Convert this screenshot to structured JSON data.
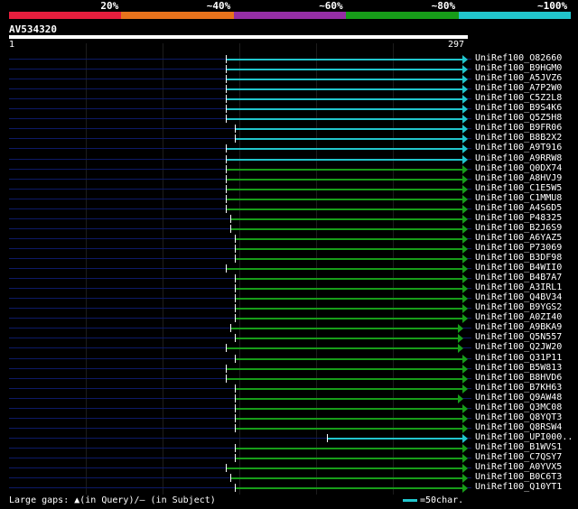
{
  "legend": {
    "segments": [
      {
        "label": "20%",
        "color": "#e51e3d"
      },
      {
        "label": "~40%",
        "color": "#e8731c"
      },
      {
        "label": "~60%",
        "color": "#952ea5"
      },
      {
        "label": "~80%",
        "color": "#179d19"
      },
      {
        "label": "~100%",
        "color": "#21c5cc"
      }
    ]
  },
  "query": {
    "name": "AV534320",
    "start_label": "1",
    "end_label": "297",
    "length": 297
  },
  "colors": {
    "cyan": "#21c5cc",
    "green": "#179d19",
    "track": "#0d1a66"
  },
  "hits": [
    {
      "name": "UniRef100_O82660",
      "start": 142,
      "end": 297,
      "color": "cyan"
    },
    {
      "name": "UniRef100_B9HGM0",
      "start": 142,
      "end": 297,
      "color": "cyan"
    },
    {
      "name": "UniRef100_A5JVZ6",
      "start": 142,
      "end": 297,
      "color": "cyan"
    },
    {
      "name": "UniRef100_A7P2W0",
      "start": 142,
      "end": 297,
      "color": "cyan"
    },
    {
      "name": "UniRef100_C5Z2L8",
      "start": 142,
      "end": 297,
      "color": "cyan"
    },
    {
      "name": "UniRef100_B9S4K6",
      "start": 142,
      "end": 297,
      "color": "cyan"
    },
    {
      "name": "UniRef100_Q5Z5H8",
      "start": 142,
      "end": 297,
      "color": "cyan"
    },
    {
      "name": "UniRef100_B9FR06",
      "start": 148,
      "end": 297,
      "color": "cyan"
    },
    {
      "name": "UniRef100_B8B2X2",
      "start": 148,
      "end": 297,
      "color": "cyan"
    },
    {
      "name": "UniRef100_A9T916",
      "start": 142,
      "end": 297,
      "color": "cyan"
    },
    {
      "name": "UniRef100_A9RRW8",
      "start": 142,
      "end": 297,
      "color": "cyan"
    },
    {
      "name": "UniRef100_Q0DX74",
      "start": 142,
      "end": 297,
      "color": "green"
    },
    {
      "name": "UniRef100_A8HVJ9",
      "start": 142,
      "end": 297,
      "color": "green"
    },
    {
      "name": "UniRef100_C1E5W5",
      "start": 142,
      "end": 297,
      "color": "green"
    },
    {
      "name": "UniRef100_C1MMU8",
      "start": 142,
      "end": 297,
      "color": "green"
    },
    {
      "name": "UniRef100_A4S6D5",
      "start": 142,
      "end": 297,
      "color": "green"
    },
    {
      "name": "UniRef100_P48325",
      "start": 145,
      "end": 297,
      "color": "green"
    },
    {
      "name": "UniRef100_B2J6S9",
      "start": 145,
      "end": 297,
      "color": "green"
    },
    {
      "name": "UniRef100_A6YAZ5",
      "start": 148,
      "end": 297,
      "color": "green"
    },
    {
      "name": "UniRef100_P73069",
      "start": 148,
      "end": 297,
      "color": "green"
    },
    {
      "name": "UniRef100_B3DF98",
      "start": 148,
      "end": 297,
      "color": "green"
    },
    {
      "name": "UniRef100_B4WII0",
      "start": 142,
      "end": 297,
      "color": "green"
    },
    {
      "name": "UniRef100_B4B7A7",
      "start": 148,
      "end": 297,
      "color": "green"
    },
    {
      "name": "UniRef100_A3IRL1",
      "start": 148,
      "end": 297,
      "color": "green"
    },
    {
      "name": "UniRef100_Q4BV34",
      "start": 148,
      "end": 297,
      "color": "green"
    },
    {
      "name": "UniRef100_B9YGS2",
      "start": 148,
      "end": 297,
      "color": "green"
    },
    {
      "name": "UniRef100_A0ZI40",
      "start": 148,
      "end": 297,
      "color": "green"
    },
    {
      "name": "UniRef100_A9BKA9",
      "start": 145,
      "end": 294,
      "color": "green"
    },
    {
      "name": "UniRef100_Q5N557",
      "start": 148,
      "end": 294,
      "color": "green"
    },
    {
      "name": "UniRef100_Q2JW20",
      "start": 142,
      "end": 294,
      "color": "green"
    },
    {
      "name": "UniRef100_Q31P11",
      "start": 148,
      "end": 297,
      "color": "green"
    },
    {
      "name": "UniRef100_B5W813",
      "start": 142,
      "end": 297,
      "color": "green"
    },
    {
      "name": "UniRef100_B8HVD6",
      "start": 142,
      "end": 297,
      "color": "green"
    },
    {
      "name": "UniRef100_B7KH63",
      "start": 148,
      "end": 297,
      "color": "green"
    },
    {
      "name": "UniRef100_Q9AW48",
      "start": 148,
      "end": 294,
      "color": "green"
    },
    {
      "name": "UniRef100_Q3MC08",
      "start": 148,
      "end": 297,
      "color": "green"
    },
    {
      "name": "UniRef100_Q8YQT3",
      "start": 148,
      "end": 297,
      "color": "green"
    },
    {
      "name": "UniRef100_Q8RSW4",
      "start": 148,
      "end": 297,
      "color": "green"
    },
    {
      "name": "UniRef100_UPI000..",
      "start": 208,
      "end": 297,
      "color": "cyan"
    },
    {
      "name": "UniRef100_B1WVS1",
      "start": 148,
      "end": 297,
      "color": "green"
    },
    {
      "name": "UniRef100_C7QSY7",
      "start": 148,
      "end": 297,
      "color": "green"
    },
    {
      "name": "UniRef100_A0YVX5",
      "start": 142,
      "end": 297,
      "color": "green"
    },
    {
      "name": "UniRef100_B0C6T3",
      "start": 145,
      "end": 297,
      "color": "green"
    },
    {
      "name": "UniRef100_Q10YT1",
      "start": 148,
      "end": 297,
      "color": "green"
    }
  ],
  "footer": {
    "gaps_text": "Large gaps: ▲(in Query)/– (in Subject)",
    "scale_text": "=50char."
  }
}
